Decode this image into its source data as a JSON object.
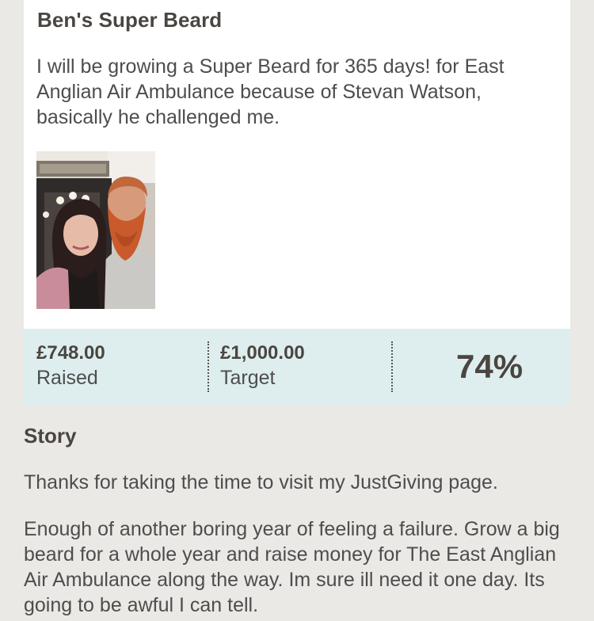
{
  "fundraiser": {
    "title": "Ben's Super Beard",
    "summary": "I will be growing a Super Beard for 365 days! for East Anglian Air Ambulance because of Stevan Watson, basically he challenged me."
  },
  "stats": {
    "raised_amount": "£748.00",
    "raised_label": "Raised",
    "target_amount": "£1,000.00",
    "target_label": "Target",
    "percent": "74%",
    "progress_fraction": 0.748
  },
  "story": {
    "heading": "Story",
    "paragraphs": [
      "Thanks for taking the time to visit my JustGiving page.",
      "Enough of another boring year of feeling a failure. Grow a big beard for a whole year and raise money for The East Anglian Air Ambulance along the way. Im sure ill need it one day. Its going to be awful I can tell."
    ]
  },
  "colors": {
    "page_background": "#ebe9e6",
    "card_background": "#ffffff",
    "stats_background": "#deeeee",
    "heading_text": "#4a4540",
    "body_text": "#4d4d4d"
  }
}
